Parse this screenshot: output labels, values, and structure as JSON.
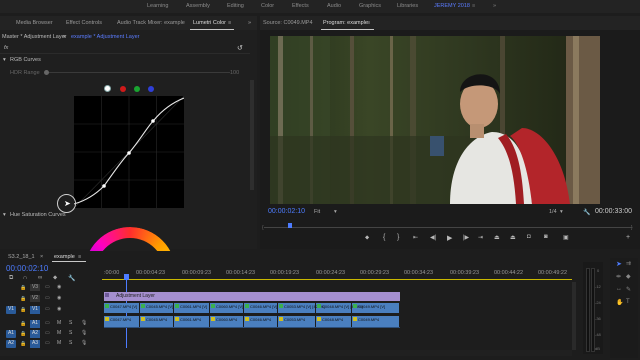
{
  "workspaces": [
    {
      "label": "Learning"
    },
    {
      "label": "Assembly"
    },
    {
      "label": "Editing"
    },
    {
      "label": "Color"
    },
    {
      "label": "Effects"
    },
    {
      "label": "Audio"
    },
    {
      "label": "Graphics"
    },
    {
      "label": "Libraries"
    },
    {
      "label": "JEREMY 2018"
    }
  ],
  "overflow_icon": "double-chevron-right-icon",
  "left_tabs": [
    {
      "label": "Media Browser"
    },
    {
      "label": "Effect Controls"
    },
    {
      "label": "Audio Track Mixer: example"
    },
    {
      "label": "Lumetri Color"
    }
  ],
  "lumetri": {
    "master_label": "Master * Adjustment Layer",
    "clip_label": "example * Adjustment Layer",
    "fx_label": "fx",
    "rgb_curves_label": "RGB Curves",
    "hdr_range_label": "HDR Range",
    "hdr_value": "100",
    "hue_sat_label": "Hue Saturation Curves",
    "channel_colors": [
      "#ffffff",
      "#d01a1a",
      "#1aa531",
      "#2f3fd8"
    ]
  },
  "monitor_tabs": [
    {
      "label": "Source: C0049.MP4"
    },
    {
      "label": "Program: example"
    }
  ],
  "program": {
    "timecode": "00:00:02:10",
    "fit": "Fit",
    "quality": "1/4",
    "duration": "00:00:33:00"
  },
  "timeline": {
    "tabs": [
      {
        "label": "S3.2_18_1"
      },
      {
        "label": "example"
      }
    ],
    "timecode": "00:00:02:10",
    "ruler": [
      ":00:00",
      "00:00:04:23",
      "00:00:09:23",
      "00:00:14:23",
      "00:00:19:23",
      "00:00:24:23",
      "00:00:29:23",
      "00:00:34:23",
      "00:00:39:23",
      "00:00:44:22",
      "00:00:49:22"
    ],
    "tracks": [
      "V3",
      "V2",
      "V1",
      "A1",
      "A2",
      "A3"
    ],
    "adjustment_layer_label": "Adjustment Layer",
    "v1_clips": [
      "C0047.MP4 [V]",
      "C0045.MP4 [V]",
      "C0061.MP4 [V]",
      "C0060.MP4 [V]",
      "C0046.MP4 [V]",
      "C0053.MP4 [V] [425%]",
      "C0048.MP4 [V] [425%]",
      "C0049.MP4 [V]"
    ],
    "a1_clips": [
      "C0047.MP4",
      "C0045.MP4",
      "C0061.MP4",
      "C0060.MP4",
      "C0046.MP4",
      "C0053.MP4",
      "C0048.MP4",
      "C0049.MP4"
    ],
    "track_letters": {
      "m": "M",
      "s": "S"
    },
    "meter_labels": [
      "0",
      "-12",
      "-24",
      "-36",
      "-48",
      "dB"
    ]
  }
}
